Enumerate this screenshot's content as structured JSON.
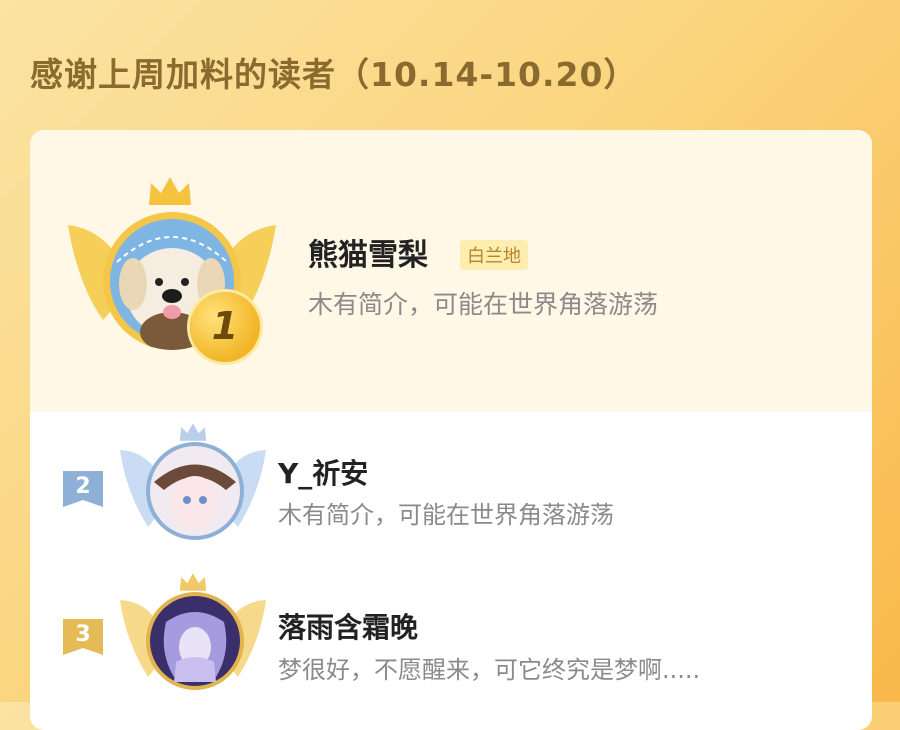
{
  "header": {
    "title": "感谢上周加料的读者（10.14-10.20）"
  },
  "ranking": [
    {
      "rank": "1",
      "name": "熊猫雪梨",
      "badge": "白兰地",
      "bio": "木有简介，可能在世界角落游荡"
    },
    {
      "rank": "2",
      "name": "Y_祈安",
      "bio": "木有简介，可能在世界角落游荡"
    },
    {
      "rank": "3",
      "name": "落雨含霜晚",
      "bio": "梦很好，不愿醒来，可它终究是梦啊....."
    }
  ],
  "colors": {
    "gold": "#f2b527",
    "silver": "#8fb0d6",
    "bronze": "#e5bb57",
    "accent_text": "#8a6a2e"
  }
}
